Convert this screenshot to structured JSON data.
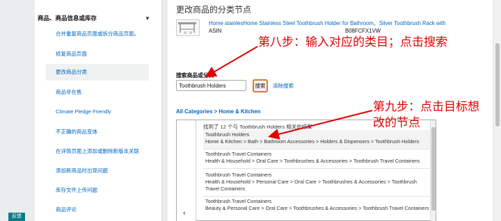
{
  "sidebar": {
    "feedback_label": "反馈"
  },
  "nav": {
    "header": "商品、商品信息或库存",
    "items": [
      "合并重复商品页面或拆分商品页面。",
      "修复商品页面",
      "更改商品分类",
      "商品非在售",
      "Climate Pledge Friendly",
      "不正确的商品变体",
      "在详情页面上添加或删除新版本关联",
      "添加新商品时出现问题",
      "库存文件上传问题",
      "商品评论"
    ],
    "active_index": 2
  },
  "main": {
    "title": "更改商品的分类节点",
    "product": {
      "title": "Home stainlesHome Stainless Steel Toothbrush Holder for Bathroom、Silver Toothbrush Rack with",
      "asin_label": "ASIN",
      "asin_value": "B08FCFX1VW"
    },
    "search": {
      "label": "搜索商品或分类",
      "value": "Toothbrush Holders",
      "button_label": "搜索",
      "clear_label": "清除搜索"
    },
    "breadcrumb": "All Categories > Home & Kitchen",
    "results": {
      "summary": "找到了 12 个与 Toothbrush Holders 相关的结果",
      "items": [
        {
          "name": "Toothbrush Holders",
          "path": "Home & Kitchen > Bath > Bathroom Accessories > Holders & Dispensers > Toothbrush Holders"
        },
        {
          "name": "Toothbrush Travel Containers",
          "path": "Health & Household > Oral Care > Toothbrushes & Accessories > Toothbrush Travel Containers"
        },
        {
          "name": "Toothbrush Travel Containers",
          "path": "Health & Household > Personal Care > Oral Care > Toothbrushes & Accessories > Toothbrush Travel Containers"
        },
        {
          "name": "Toothbrush Travel Containers",
          "path": "Beauty & Personal Care > Oral Care > Toothbrushes & Accessories > Toothbrush Travel Containers"
        }
      ]
    }
  },
  "annotations": {
    "step8": "第八步：输入对应的类目；点击搜索",
    "step9_line1": "第九步：点击目标想",
    "step9_line2": "改的节点"
  },
  "colors": {
    "annotation": "#e00000",
    "link": "#0066c0",
    "search_button_border": "#e47911",
    "feedback_bg": "#0f7b8a"
  }
}
